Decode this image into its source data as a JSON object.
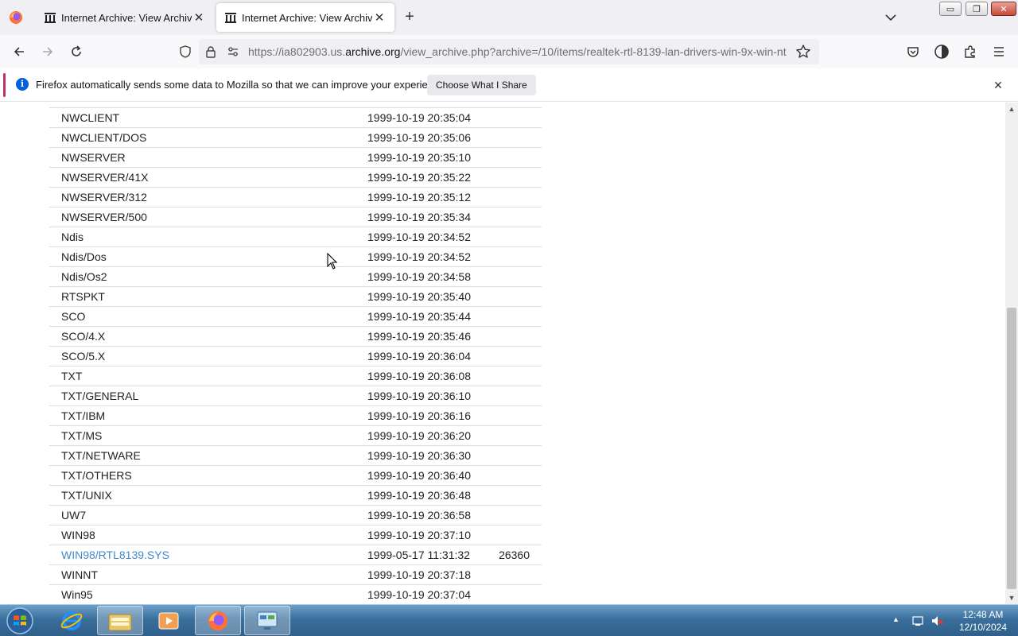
{
  "browser": {
    "tabs": [
      {
        "title": "Internet Archive: View Archive",
        "active": false
      },
      {
        "title": "Internet Archive: View Archive",
        "active": true
      }
    ],
    "url": {
      "prefix": "https://ia802903.us.",
      "domain": "archive.org",
      "path": "/view_archive.php?archive=/10/items/realtek-rtl-8139-lan-drivers-win-9x-win-nt"
    },
    "window_controls": {
      "minimize": "▭",
      "maximize": "❐",
      "close": "✕"
    },
    "tab_close": "✕",
    "new_tab": "+"
  },
  "notification": {
    "text": "Firefox automatically sends some data to Mozilla so that we can improve your experience.",
    "button": "Choose What I Share",
    "info_glyph": "i",
    "close": "✕"
  },
  "files": [
    {
      "name": "NWCLIENT",
      "date": "1999-10-19 20:35:04",
      "size": "",
      "link": false
    },
    {
      "name": "NWCLIENT/DOS",
      "date": "1999-10-19 20:35:06",
      "size": "",
      "link": false
    },
    {
      "name": "NWSERVER",
      "date": "1999-10-19 20:35:10",
      "size": "",
      "link": false
    },
    {
      "name": "NWSERVER/41X",
      "date": "1999-10-19 20:35:22",
      "size": "",
      "link": false
    },
    {
      "name": "NWSERVER/312",
      "date": "1999-10-19 20:35:12",
      "size": "",
      "link": false
    },
    {
      "name": "NWSERVER/500",
      "date": "1999-10-19 20:35:34",
      "size": "",
      "link": false
    },
    {
      "name": "Ndis",
      "date": "1999-10-19 20:34:52",
      "size": "",
      "link": false
    },
    {
      "name": "Ndis/Dos",
      "date": "1999-10-19 20:34:52",
      "size": "",
      "link": false
    },
    {
      "name": "Ndis/Os2",
      "date": "1999-10-19 20:34:58",
      "size": "",
      "link": false
    },
    {
      "name": "RTSPKT",
      "date": "1999-10-19 20:35:40",
      "size": "",
      "link": false
    },
    {
      "name": "SCO",
      "date": "1999-10-19 20:35:44",
      "size": "",
      "link": false
    },
    {
      "name": "SCO/4.X",
      "date": "1999-10-19 20:35:46",
      "size": "",
      "link": false
    },
    {
      "name": "SCO/5.X",
      "date": "1999-10-19 20:36:04",
      "size": "",
      "link": false
    },
    {
      "name": "TXT",
      "date": "1999-10-19 20:36:08",
      "size": "",
      "link": false
    },
    {
      "name": "TXT/GENERAL",
      "date": "1999-10-19 20:36:10",
      "size": "",
      "link": false
    },
    {
      "name": "TXT/IBM",
      "date": "1999-10-19 20:36:16",
      "size": "",
      "link": false
    },
    {
      "name": "TXT/MS",
      "date": "1999-10-19 20:36:20",
      "size": "",
      "link": false
    },
    {
      "name": "TXT/NETWARE",
      "date": "1999-10-19 20:36:30",
      "size": "",
      "link": false
    },
    {
      "name": "TXT/OTHERS",
      "date": "1999-10-19 20:36:40",
      "size": "",
      "link": false
    },
    {
      "name": "TXT/UNIX",
      "date": "1999-10-19 20:36:48",
      "size": "",
      "link": false
    },
    {
      "name": "UW7",
      "date": "1999-10-19 20:36:58",
      "size": "",
      "link": false
    },
    {
      "name": "WIN98",
      "date": "1999-10-19 20:37:10",
      "size": "",
      "link": false
    },
    {
      "name": "WIN98/RTL8139.SYS",
      "date": "1999-05-17 11:31:32",
      "size": "26360",
      "link": true
    },
    {
      "name": "WINNT",
      "date": "1999-10-19 20:37:18",
      "size": "",
      "link": false
    },
    {
      "name": "Win95",
      "date": "1999-10-19 20:37:04",
      "size": "",
      "link": false
    }
  ],
  "scrollbar": {
    "up": "▲",
    "down": "▼"
  },
  "taskbar": {
    "apps": [
      "internet-explorer-icon",
      "file-explorer-icon",
      "media-player-icon",
      "firefox-icon",
      "control-panel-icon"
    ],
    "tray_expand": "▲",
    "time": "12:48 AM",
    "date": "12/10/2024"
  },
  "colors": {
    "link": "#428bca",
    "notice_accent": "#c0306a",
    "info": "#0060df"
  }
}
